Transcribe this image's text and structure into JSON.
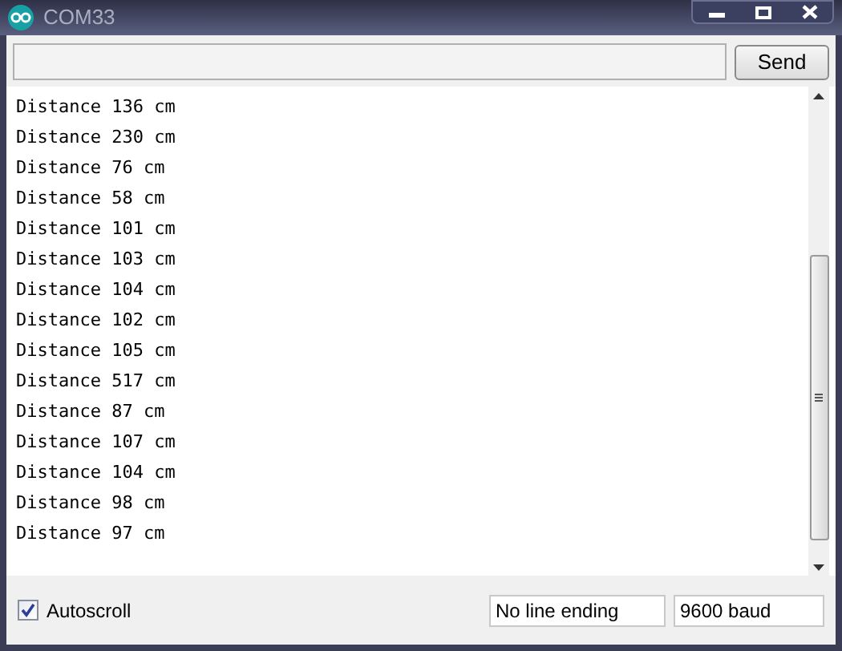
{
  "window": {
    "title": "COM33"
  },
  "send_button": "Send",
  "output_lines": [
    "Distance 136 cm",
    "Distance 230 cm",
    "Distance 76 cm",
    "Distance 58 cm",
    "Distance 101 cm",
    "Distance 103 cm",
    "Distance 104 cm",
    "Distance 102 cm",
    "Distance 105 cm",
    "Distance 517 cm",
    "Distance 87 cm",
    "Distance 107 cm",
    "Distance 104 cm",
    "Distance 98 cm",
    "Distance 97 cm"
  ],
  "autoscroll": {
    "label": "Autoscroll",
    "checked": true
  },
  "line_ending": "No line ending",
  "baud_rate": "9600 baud"
}
